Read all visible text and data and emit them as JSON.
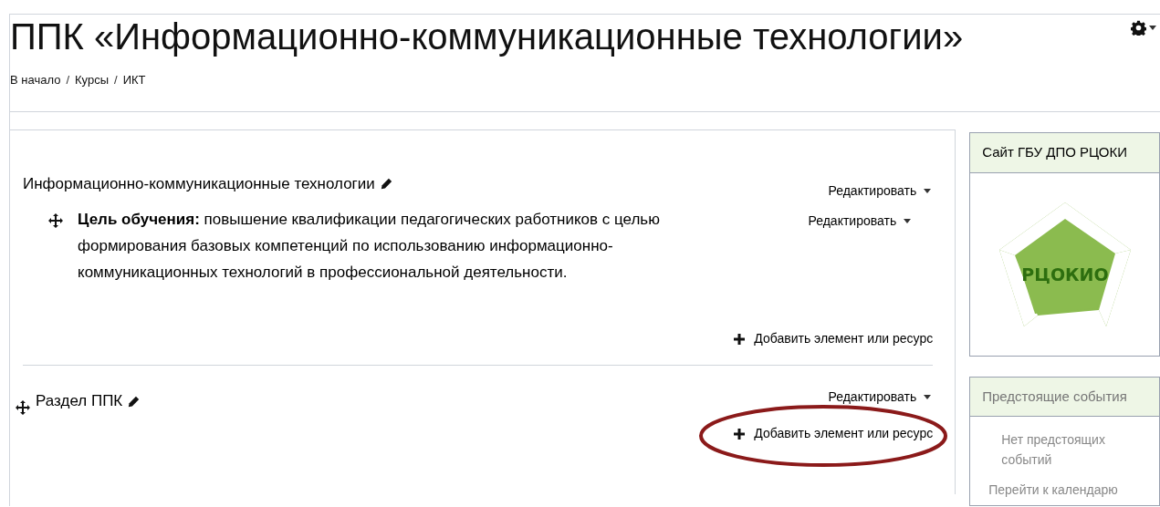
{
  "page_title": "ППК «Информационно-коммуникационные технологии»",
  "breadcrumb": [
    "В начало",
    "Курсы",
    "ИКТ"
  ],
  "breadcrumb_separator": "/",
  "sections": [
    {
      "title": "Информационно-коммуникационные технологии",
      "edit_label": "Редактировать",
      "items": [
        {
          "summary": "**Цель обучения:** повышение квалификации педагогических работников с целью формирования базовых компетенций по использованию информационно-коммуникационных технологий в профессиональной деятельности.",
          "edit_label": "Редактировать"
        }
      ],
      "add_label": "Добавить элемент или ресурс",
      "highlighted": false
    },
    {
      "title": "Раздел ППК",
      "edit_label": "Редактировать",
      "add_label": "Добавить элемент или ресурс",
      "highlighted": true
    }
  ],
  "blocks": [
    {
      "kind": "logo",
      "title": "Сайт ГБУ ДПО РЦОКИ",
      "logo_text": "РЦОКИО"
    },
    {
      "kind": "events",
      "title": "Предстоящие события",
      "empty_text": "Нет предстоящих событий",
      "link": "Перейти к календарю"
    }
  ]
}
